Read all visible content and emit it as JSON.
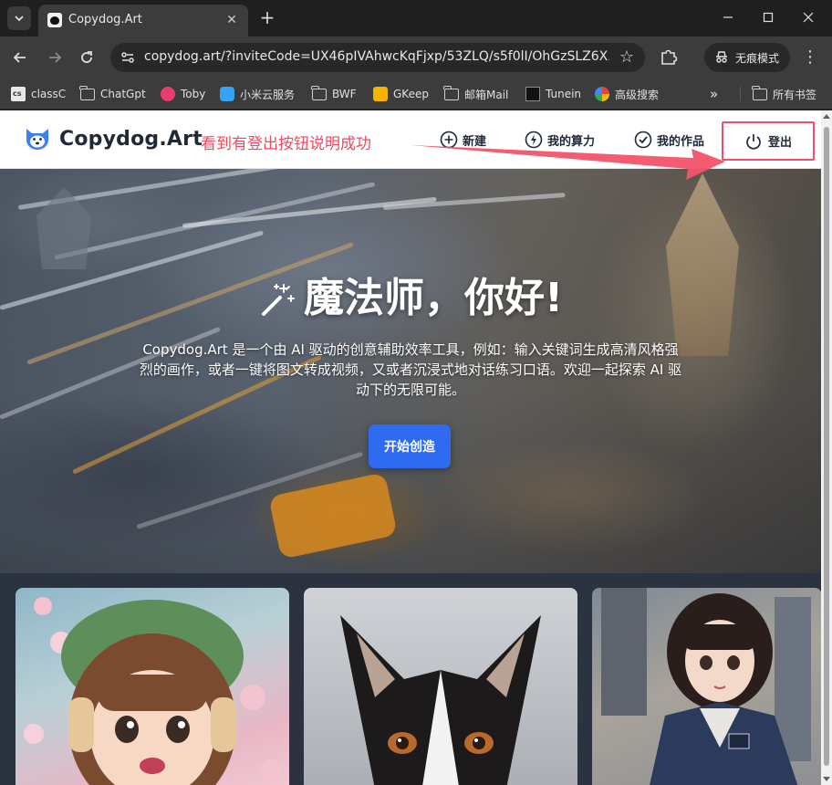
{
  "browser": {
    "tab": {
      "title": "Copydog.Art"
    },
    "address": {
      "url": "copydog.art/?inviteCode=UX46pIVAhwcKqFjxp/53ZLQ/s5f0lI/OhGzSLZ6X..."
    },
    "incognito_label": "无痕模式",
    "bookmarks": [
      {
        "label": "classC",
        "icon": "class-icon"
      },
      {
        "label": "ChatGpt",
        "icon": "folder-icon"
      },
      {
        "label": "Toby",
        "icon": "toby-icon"
      },
      {
        "label": "小米云服务",
        "icon": "cloud-icon"
      },
      {
        "label": "BWF",
        "icon": "folder-icon"
      },
      {
        "label": "GKeep",
        "icon": "keep-icon"
      },
      {
        "label": "邮箱Mail",
        "icon": "folder-icon"
      },
      {
        "label": "Tunein",
        "icon": "tunein-icon"
      },
      {
        "label": "高级搜索",
        "icon": "google-icon"
      }
    ],
    "bookmarks_overflow": "»",
    "all_bookmarks": "所有书签"
  },
  "site": {
    "brand": "Copydog.Art",
    "annotation": "看到有登出按钮说明成功",
    "nav": {
      "create": "新建",
      "power": "我的算力",
      "works": "我的作品",
      "logout": "登出"
    },
    "hero": {
      "title": "魔法师，你好!",
      "description": "Copydog.Art 是一个由 AI 驱动的创意辅助效率工具，例如：输入关键词生成高清风格强烈的画作，或者一键将图文转成视频，又或者沉浸式地对话练习口语。欢迎一起探索 AI 驱动下的无限可能。",
      "cta": "开始创造"
    }
  },
  "colors": {
    "annotation": "#ef4a60",
    "cta": "#2f6bf0",
    "logo_blue": "#3b82f6"
  }
}
